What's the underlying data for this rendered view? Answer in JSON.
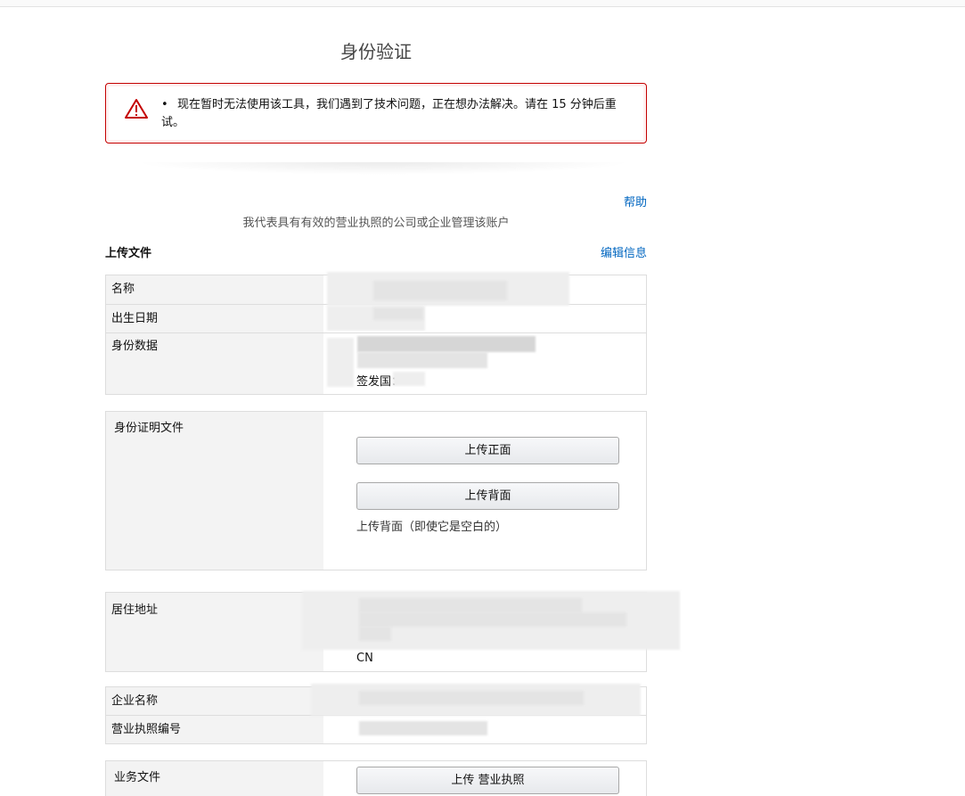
{
  "page": {
    "title": "身份验证"
  },
  "alert": {
    "bullet": "•",
    "message": "现在暂时无法使用该工具，我们遇到了技术问题，正在想办法解决。请在 15 分钟后重试。"
  },
  "links": {
    "help": "帮助",
    "edit": "编辑信息"
  },
  "subtitle": "我代表具有有效的营业执照的公司或企业管理该账户",
  "section": {
    "upload_title": "上传文件"
  },
  "personal_info": {
    "name_label": "名称",
    "dob_label": "出生日期",
    "id_label": "身份数据",
    "issuing_country_prefix": "签发国："
  },
  "id_document": {
    "label": "身份证明文件",
    "upload_front": "上传正面",
    "upload_back": "上传背面",
    "back_note": "上传背面（即使它是空白的）"
  },
  "address": {
    "label": "居住地址",
    "country": "CN"
  },
  "business": {
    "company_name_label": "企业名称",
    "license_number_label": "营业执照编号"
  },
  "business_docs": {
    "label": "业务文件",
    "upload_license": "上传 营业执照"
  },
  "colors": {
    "alert_border": "#c40000",
    "link": "#0066c0",
    "label_bg": "#f3f3f3"
  }
}
